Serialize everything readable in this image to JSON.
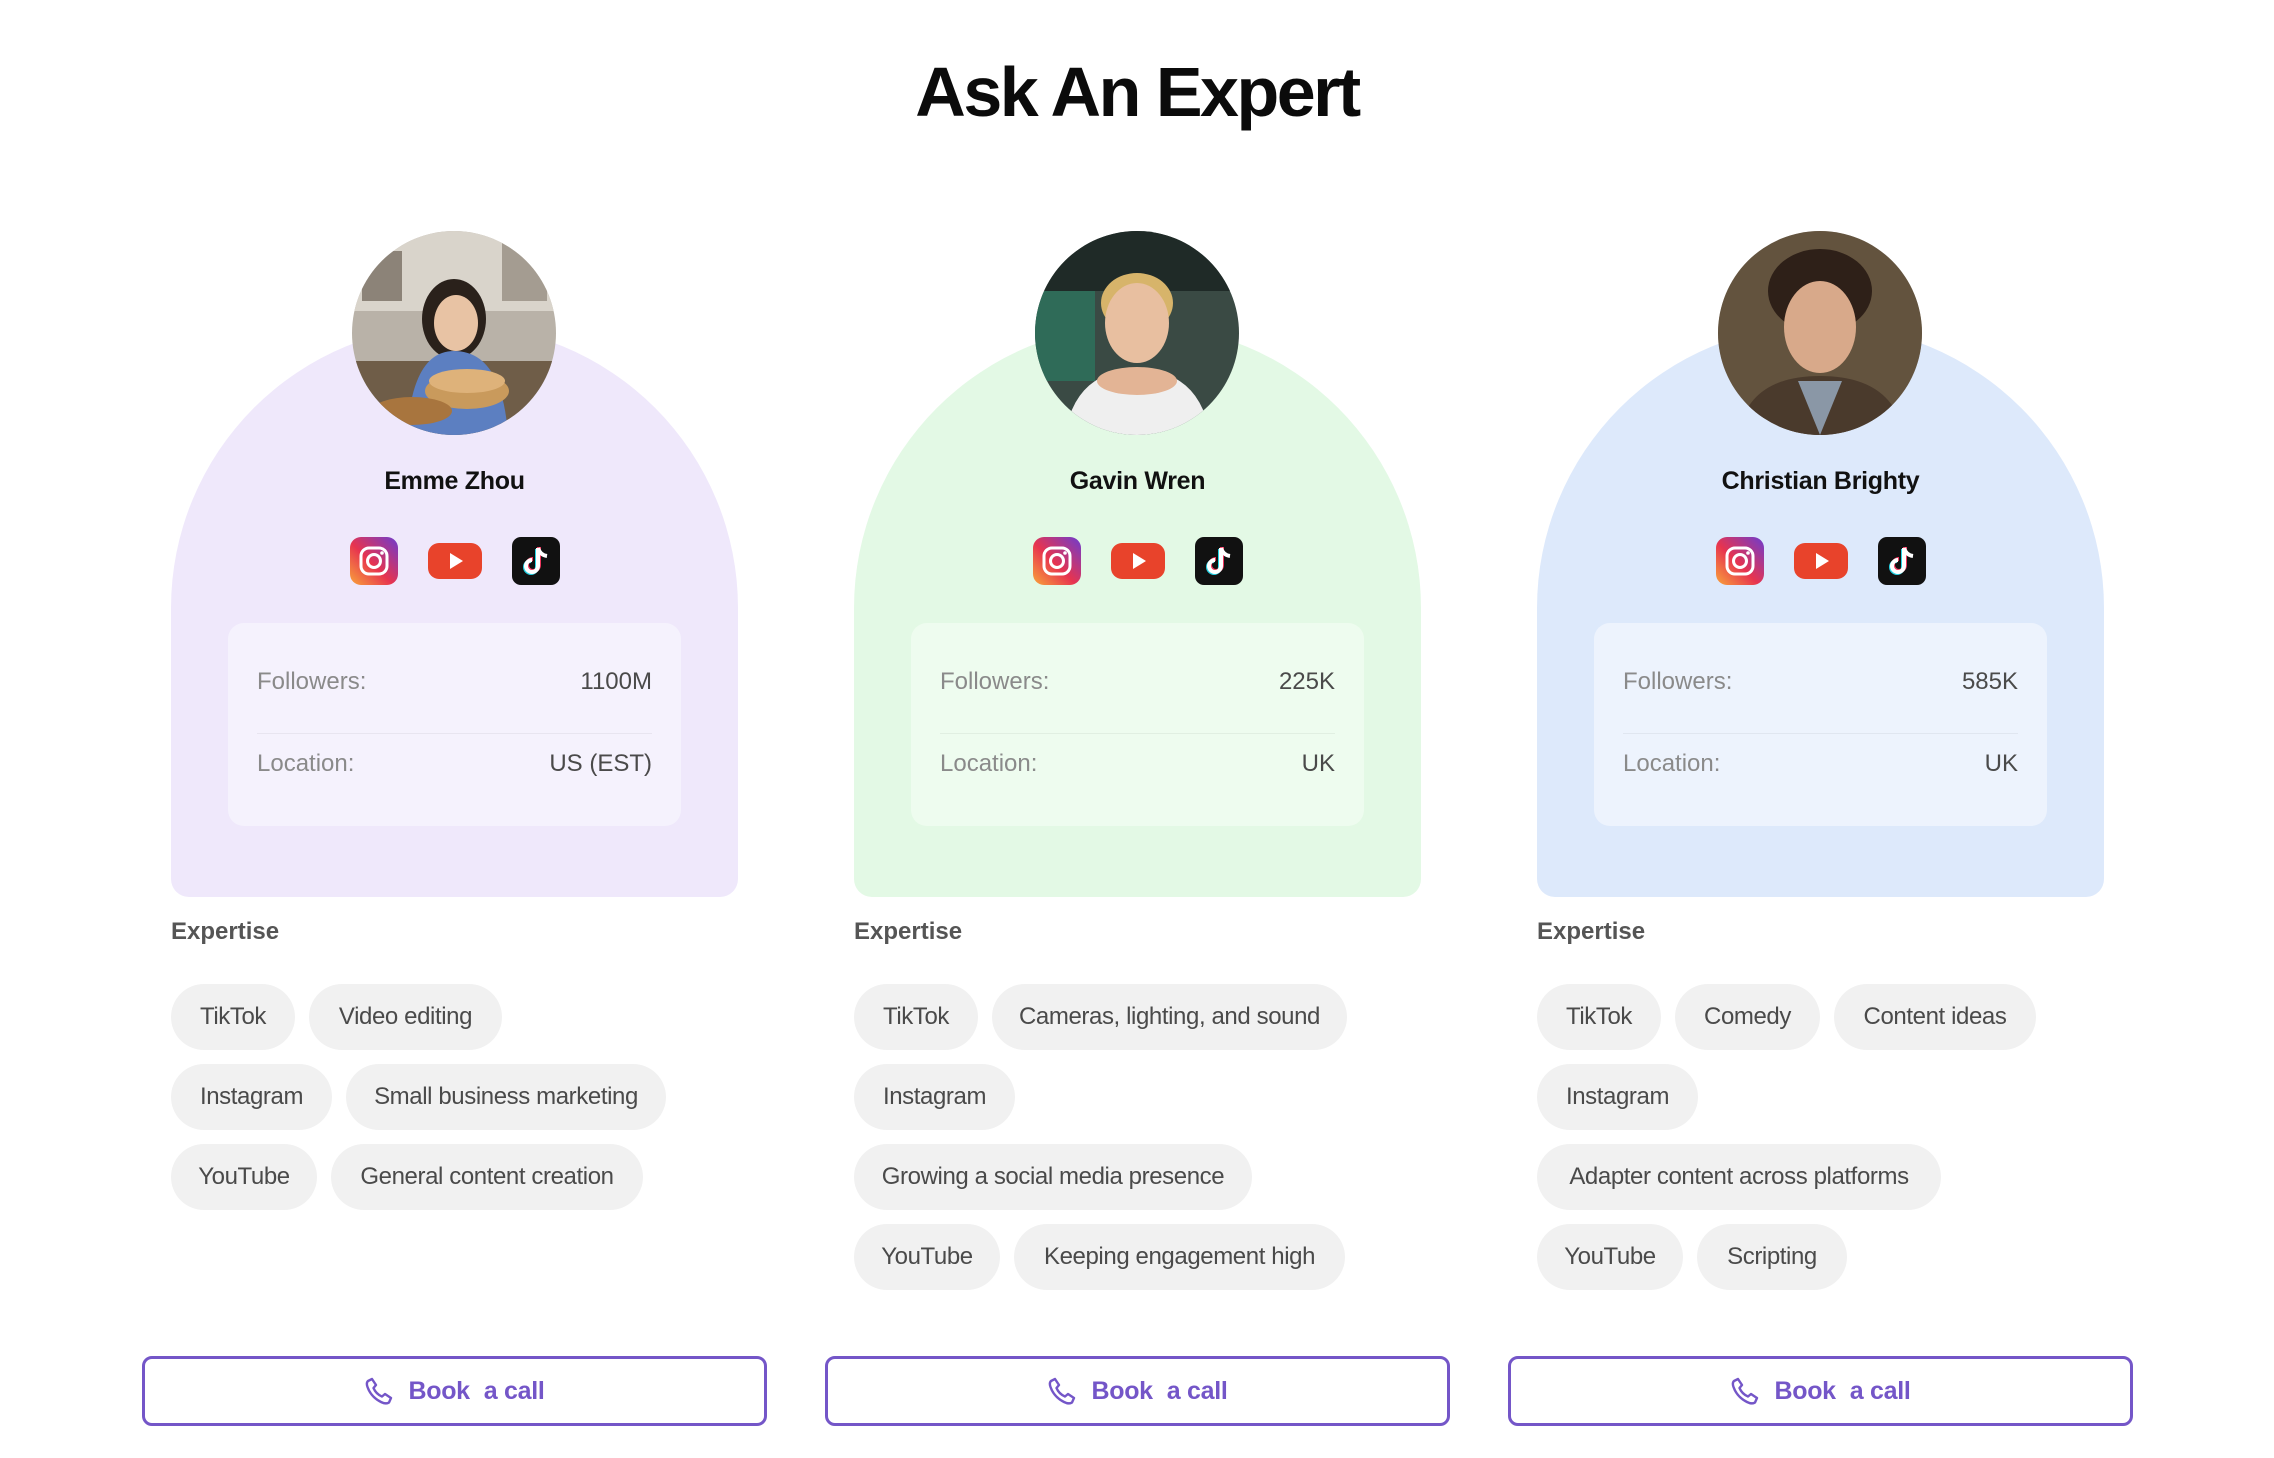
{
  "page": {
    "title": "Ask An Expert"
  },
  "labels": {
    "followers": "Followers:",
    "location": "Location:",
    "expertise": "Expertise",
    "book_word1": "Book",
    "book_word2": "a call"
  },
  "experts": [
    {
      "name": "Emme Zhou",
      "followers": "1100M",
      "location": "US (EST)",
      "arch_color": "#efe8fb",
      "stats_color": "#f5f2fd",
      "expertise": [
        "TikTok",
        "Video editing",
        "Instagram",
        "Small business marketing",
        "YouTube",
        "General content creation"
      ]
    },
    {
      "name": "Gavin Wren",
      "followers": "225K",
      "location": "UK",
      "arch_color": "#e3f9e5",
      "stats_color": "#eefcef",
      "expertise": [
        "TikTok",
        "Cameras, lighting, and sound",
        "Instagram",
        "Growing a social media presence",
        "YouTube",
        "Keeping engagement high"
      ]
    },
    {
      "name": "Christian Brighty",
      "followers": "585K",
      "location": "UK",
      "arch_color": "#dde9fb",
      "stats_color": "#edf3fd",
      "expertise": [
        "TikTok",
        "Comedy",
        "Content ideas",
        "Instagram",
        "Adapter content across platforms",
        "YouTube",
        "Scripting"
      ]
    }
  ],
  "icons": {
    "instagram": "instagram-icon",
    "youtube": "youtube-icon",
    "tiktok": "tiktok-icon",
    "phone": "phone-icon"
  },
  "colors": {
    "accent": "#7456c8",
    "tag_bg": "#f1f1f1",
    "youtube": "#e8432b",
    "tiktok": "#111111"
  }
}
